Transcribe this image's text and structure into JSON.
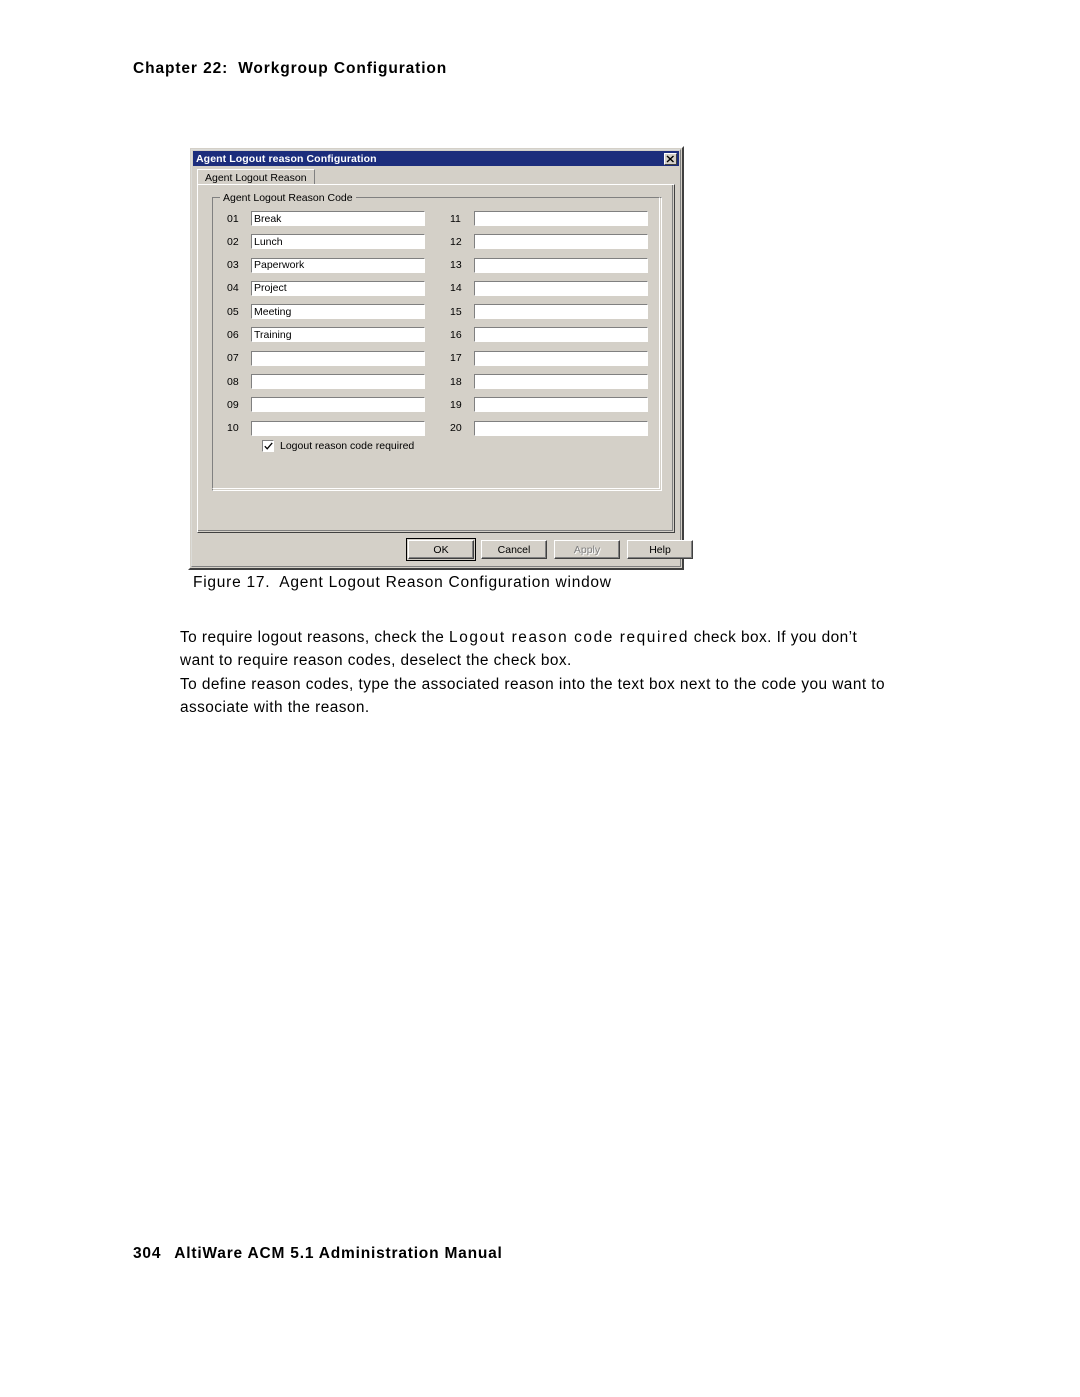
{
  "page": {
    "chapter_label": "Chapter 22:",
    "chapter_title": "Workgroup Configuration",
    "footer_page_number": "304",
    "footer_text": "AltiWare ACM 5.1 Administration Manual"
  },
  "figure": {
    "number": "Figure 17.",
    "caption": "Agent Logout Reason Configuration window"
  },
  "paragraphs": {
    "p1_part1": "To require logout reasons, check the ",
    "p1_emph": "Logout reason code required",
    "p1_part2": " check box. If you don’t want to require reason codes, deselect the check box.",
    "p2": "To define reason codes, type the associated reason into the text box next to the code you want to associate with the reason."
  },
  "dialog": {
    "title": "Agent Logout reason Configuration",
    "close_icon": "close-x-icon",
    "tab_label": "Agent Logout Reason",
    "group_title": "Agent Logout Reason Code",
    "checkbox": {
      "label": "Logout reason code required",
      "checked": true,
      "check_icon": "checkmark-icon"
    },
    "buttons": [
      {
        "label": "OK",
        "state": "default"
      },
      {
        "label": "Cancel",
        "state": "normal"
      },
      {
        "label": "Apply",
        "state": "disabled"
      },
      {
        "label": "Help",
        "state": "normal"
      }
    ],
    "reason_codes_left": [
      {
        "code": "01",
        "value": "Break"
      },
      {
        "code": "02",
        "value": "Lunch"
      },
      {
        "code": "03",
        "value": "Paperwork"
      },
      {
        "code": "04",
        "value": "Project"
      },
      {
        "code": "05",
        "value": "Meeting"
      },
      {
        "code": "06",
        "value": "Training"
      },
      {
        "code": "07",
        "value": ""
      },
      {
        "code": "08",
        "value": ""
      },
      {
        "code": "09",
        "value": ""
      },
      {
        "code": "10",
        "value": ""
      }
    ],
    "reason_codes_right": [
      {
        "code": "11",
        "value": ""
      },
      {
        "code": "12",
        "value": ""
      },
      {
        "code": "13",
        "value": ""
      },
      {
        "code": "14",
        "value": ""
      },
      {
        "code": "15",
        "value": ""
      },
      {
        "code": "16",
        "value": ""
      },
      {
        "code": "17",
        "value": ""
      },
      {
        "code": "18",
        "value": ""
      },
      {
        "code": "19",
        "value": ""
      },
      {
        "code": "20",
        "value": ""
      }
    ]
  },
  "colors": {
    "titlebar": "#1c2d7c",
    "dialog_face": "#d4d0c8",
    "field_bg": "#ffffff",
    "disabled_text": "#808080"
  }
}
